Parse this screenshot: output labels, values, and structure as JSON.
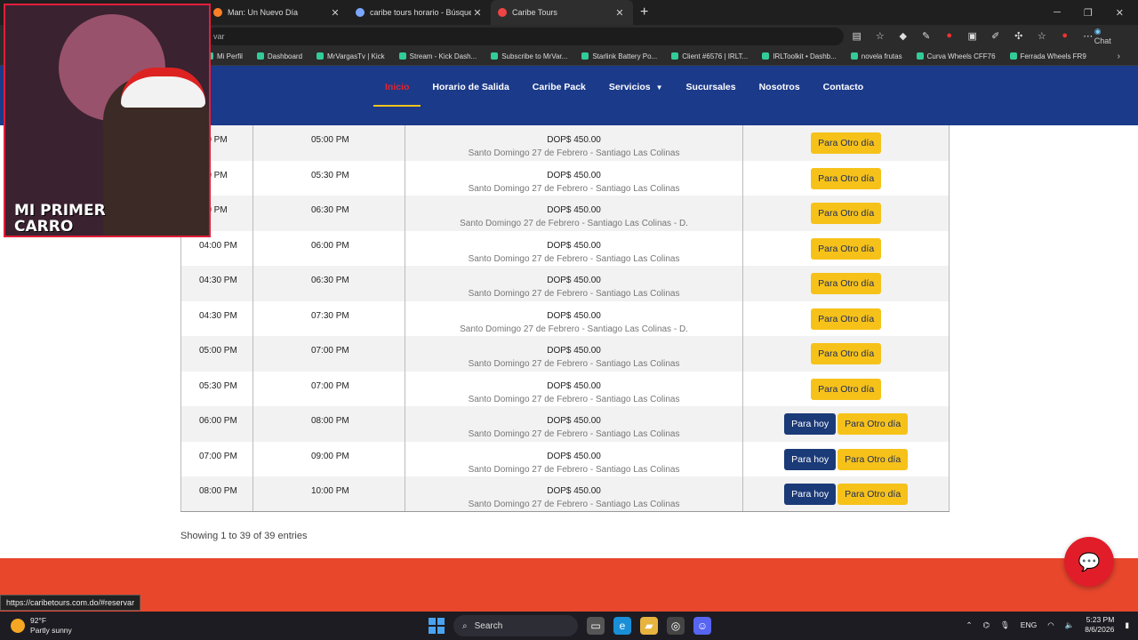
{
  "browser": {
    "tabs": [
      {
        "title": "Man: Un Nuevo Día",
        "color": "#ff7f27"
      },
      {
        "title": "caribe tours horario - Búsqueda",
        "color": "#7aa7ff"
      },
      {
        "title": "Caribe Tours",
        "color": "#e44"
      }
    ],
    "url": "var",
    "chat_label": "Chat",
    "bookmarks": [
      "Mi Perfil",
      "Dashboard",
      "MrVargasTv | Kick",
      "Stream - Kick Dash...",
      "Subscribe to MrVar...",
      "Starlink Battery Po...",
      "Client #6576 | IRLT...",
      "IRLToolkit • Dashb...",
      "novela frutas",
      "Curva Wheels CFF76",
      "Ferrada Wheels FR9"
    ]
  },
  "nav": {
    "items": [
      {
        "label": "Inicio",
        "active": true
      },
      {
        "label": "Horario de Salida"
      },
      {
        "label": "Caribe Pack"
      },
      {
        "label": "Servicios",
        "dropdown": true
      },
      {
        "label": "Sucursales"
      },
      {
        "label": "Nosotros"
      },
      {
        "label": "Contacto"
      }
    ]
  },
  "table": {
    "rows": [
      {
        "salida": ":00 PM",
        "llegada": "05:00 PM",
        "price": "DOP$ 450.00",
        "route": "Santo Domingo 27 de Febrero - Santiago Las Colinas",
        "hoy": false
      },
      {
        "salida": ":30 PM",
        "llegada": "05:30 PM",
        "price": "DOP$ 450.00",
        "route": "Santo Domingo 27 de Febrero - Santiago Las Colinas",
        "hoy": false
      },
      {
        "salida": ":30 PM",
        "llegada": "06:30 PM",
        "price": "DOP$ 450.00",
        "route": "Santo Domingo 27 de Febrero - Santiago Las Colinas - D.",
        "hoy": false
      },
      {
        "salida": "04:00 PM",
        "llegada": "06:00 PM",
        "price": "DOP$ 450.00",
        "route": "Santo Domingo 27 de Febrero - Santiago Las Colinas",
        "hoy": false
      },
      {
        "salida": "04:30 PM",
        "llegada": "06:30 PM",
        "price": "DOP$ 450.00",
        "route": "Santo Domingo 27 de Febrero - Santiago Las Colinas",
        "hoy": false
      },
      {
        "salida": "04:30 PM",
        "llegada": "07:30 PM",
        "price": "DOP$ 450.00",
        "route": "Santo Domingo 27 de Febrero - Santiago Las Colinas - D.",
        "hoy": false
      },
      {
        "salida": "05:00 PM",
        "llegada": "07:00 PM",
        "price": "DOP$ 450.00",
        "route": "Santo Domingo 27 de Febrero - Santiago Las Colinas",
        "hoy": false
      },
      {
        "salida": "05:30 PM",
        "llegada": "07:00 PM",
        "price": "DOP$ 450.00",
        "route": "Santo Domingo 27 de Febrero - Santiago Las Colinas",
        "hoy": false
      },
      {
        "salida": "06:00 PM",
        "llegada": "08:00 PM",
        "price": "DOP$ 450.00",
        "route": "Santo Domingo 27 de Febrero - Santiago Las Colinas",
        "hoy": true
      },
      {
        "salida": "07:00 PM",
        "llegada": "09:00 PM",
        "price": "DOP$ 450.00",
        "route": "Santo Domingo 27 de Febrero - Santiago Las Colinas",
        "hoy": true
      },
      {
        "salida": "08:00 PM",
        "llegada": "10:00 PM",
        "price": "DOP$ 450.00",
        "route": "Santo Domingo 27 de Febrero - Santiago Las Colinas",
        "hoy": true
      }
    ],
    "btn_hoy": "Para hoy",
    "btn_otro": "Para Otro día",
    "entries_text": "Showing 1 to 39 of 39 entries"
  },
  "status_url": "https://caribetours.com.do/#reservar",
  "cam_banner": "MI PRIMER CARRO",
  "taskbar": {
    "temp": "92°F",
    "weather": "Partly sunny",
    "search": "Search",
    "lang": "ENG",
    "time": "5:23 PM",
    "date": "8/6/2026"
  }
}
